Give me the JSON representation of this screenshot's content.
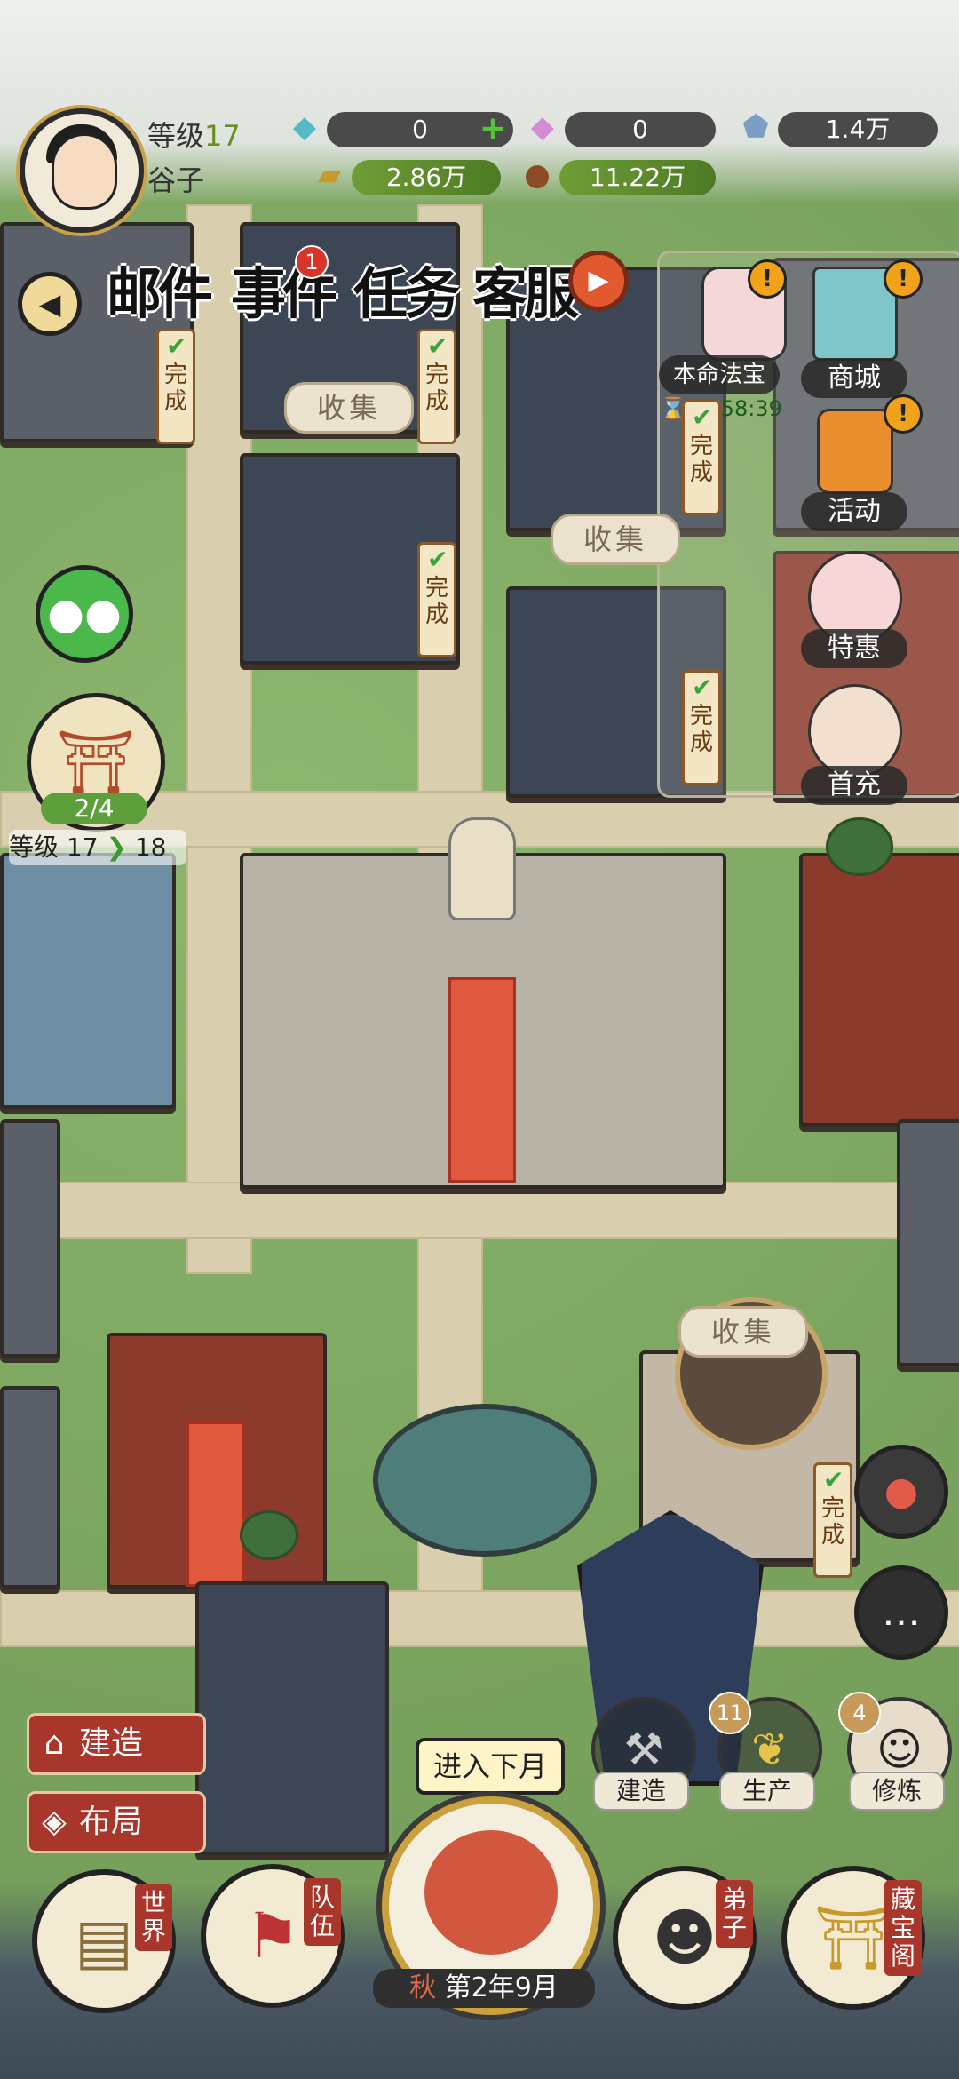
{
  "player": {
    "level_label": "等级",
    "level_value": "17",
    "name": "谷子"
  },
  "resources": {
    "gem_blue": "0",
    "gem_pink": "0",
    "crystal": "1.4万",
    "gold": "2.86万",
    "wood": "11.22万"
  },
  "top_menu": {
    "mail": "邮件",
    "event": "事件",
    "event_badge": "1",
    "task": "任务",
    "guest": "客服"
  },
  "right_menu": {
    "treasure_label": "本命法宝",
    "treasure_timer": "10:58:39",
    "shop": "商城",
    "activity": "活动",
    "discount": "特惠",
    "first_charge": "首充",
    "excl": "!"
  },
  "left_side": {
    "building_progress": "2/4",
    "level_upgrade_label": "等级",
    "level_from": "17",
    "level_to": "18"
  },
  "map": {
    "collect": "收集",
    "done": "完成"
  },
  "actions": {
    "build": "建造",
    "layout": "布局",
    "build_small": "建造",
    "produce": "生产",
    "produce_badge": "11",
    "cultivate": "修炼",
    "cultivate_badge": "4",
    "next_month": "进入下月",
    "season": "秋",
    "date": "第2年9月"
  },
  "bottom_nav": {
    "world": "世界",
    "team": "队伍",
    "disciple": "弟子",
    "treasure_pavilion": "藏宝阁"
  }
}
